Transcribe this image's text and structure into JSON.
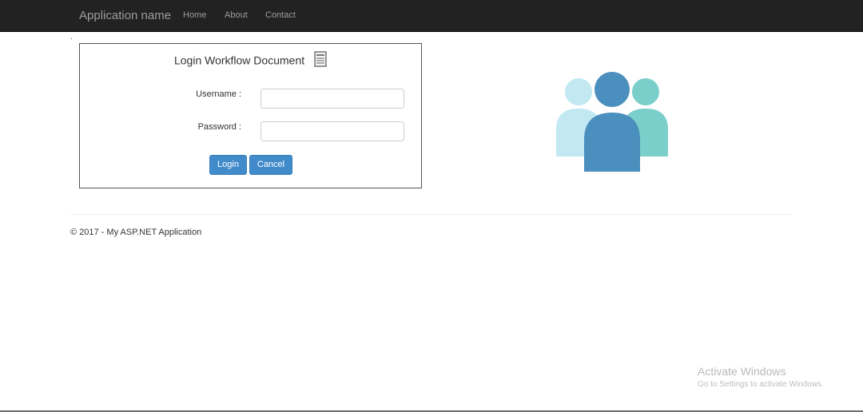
{
  "navbar": {
    "brand": "Application name",
    "links": [
      {
        "label": "Home"
      },
      {
        "label": "About"
      },
      {
        "label": "Contact"
      }
    ]
  },
  "stray_mark": ".",
  "login": {
    "title": "Login Workflow Document",
    "title_icon": "document-icon",
    "username_label": "Username :",
    "username_value": "",
    "password_label": "Password :",
    "password_value": "",
    "login_button": "Login",
    "cancel_button": "Cancel"
  },
  "illustration": {
    "icon": "users-group-icon",
    "colors": {
      "left": "#c2e8f2",
      "center": "#4a8fbe",
      "right": "#7bcfca"
    }
  },
  "footer": {
    "text": "© 2017 - My ASP.NET Application"
  },
  "watermark": {
    "title": "Activate Windows",
    "subtitle": "Go to Settings to activate Windows."
  },
  "colors": {
    "navbar_bg": "#222222",
    "nav_text": "#9d9d9d",
    "button_primary": "#428bca"
  }
}
